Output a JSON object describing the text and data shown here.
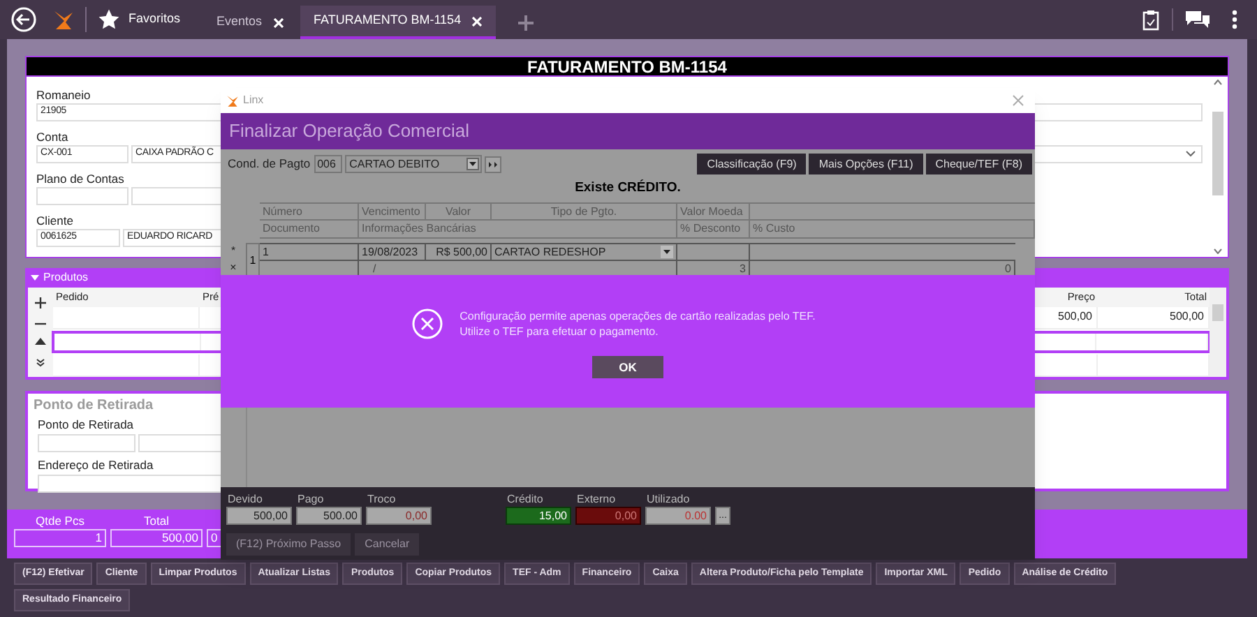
{
  "top_bar": {
    "favorites": "Favoritos",
    "tabs": [
      {
        "label": "Eventos",
        "selected": false
      },
      {
        "label": "FATURAMENTO BM-1154",
        "selected": true
      }
    ]
  },
  "form": {
    "title": "FATURAMENTO BM-1154",
    "fields": [
      {
        "kind": "single",
        "label": "Romaneio",
        "values": [
          "21905"
        ]
      },
      {
        "kind": "code_select",
        "label": "Conta",
        "values": [
          "CX-001",
          "CAIXA PADRÃO C"
        ]
      },
      {
        "kind": "pair",
        "label": "Plano de Contas"
      },
      {
        "kind": "pair",
        "label": "Cliente",
        "values": [
          "0061625",
          "EDUARDO RICARD"
        ]
      }
    ]
  },
  "products": {
    "title": "Produtos",
    "columns": [
      "Pedido",
      "Pré",
      "Preço",
      "Total"
    ],
    "rows": [
      {
        "selected": false,
        "cells": [
          "",
          "",
          "500,00",
          "500,00"
        ]
      },
      {
        "selected": true,
        "cells": []
      },
      {
        "selected": false,
        "cells": []
      }
    ]
  },
  "pickup": {
    "title": "Ponto de Retirada",
    "labels": [
      "Ponto de Retirada",
      "Endereço de Retirada"
    ]
  },
  "totals": [
    {
      "label": "Qtde Pcs",
      "value": "1"
    },
    {
      "label": "Total",
      "value": "500,00"
    },
    {
      "value": "0"
    }
  ],
  "actions": [
    "(F12) Efetivar",
    "Cliente",
    "Limpar Produtos",
    "Atualizar Listas",
    "Produtos",
    "Copiar Produtos",
    "TEF - Adm",
    "Financeiro",
    "Caixa",
    "Altera Produto/Ficha pelo Template",
    "Importar XML",
    "Pedido",
    "Análise de Crédito",
    "Resultado Financeiro"
  ],
  "dialog": {
    "title": "Linx",
    "header": "Finalizar Operação Comercial",
    "cond_label": "Cond. de Pagto",
    "cond_code": "006",
    "cond_value": "CARTAO DEBITO",
    "buttons": [
      "Classificação (F9)",
      "Mais Opções (F11)",
      "Cheque/TEF (F8)"
    ],
    "notice": "Existe CRÉDITO.",
    "header_row_1": [
      "Número",
      "Vencimento",
      "Valor",
      "Tipo de Pgto.",
      "Valor Moeda"
    ],
    "header_row_2": [
      "Documento",
      "Informações Bancárias",
      "% Desconto",
      "% Custo"
    ],
    "row": {
      "markers": [
        "*",
        "×"
      ],
      "index": "1",
      "numero": "1",
      "vencimento": "19/08/2023",
      "valor": "R$ 500,00",
      "tipo": "CARTAO REDESHOP",
      "line2_vencimento": "/",
      "line2_desconto": "3",
      "line2_custo": "0"
    },
    "amounts": [
      {
        "label": "Devido",
        "value": "500,00",
        "kind": "plain"
      },
      {
        "label": "Pago",
        "value": "500.00",
        "kind": "plain"
      },
      {
        "label": "Troco",
        "value": "0,00",
        "kind": "negative"
      },
      {
        "label": "Crédito",
        "value": "15,00",
        "kind": "credit"
      },
      {
        "label": "Externo",
        "value": "0,00",
        "kind": "external"
      },
      {
        "label": "Utilizado",
        "value": "0.00",
        "kind": "used"
      }
    ],
    "more": "...",
    "footer_buttons": [
      "(F12) Próximo Passo",
      "Cancelar"
    ]
  },
  "message": {
    "lines": [
      "Configuração permite apenas operações de cartão realizadas pelo TEF.",
      "Utilize o TEF para efetuar o pagamento."
    ],
    "button": "OK"
  }
}
